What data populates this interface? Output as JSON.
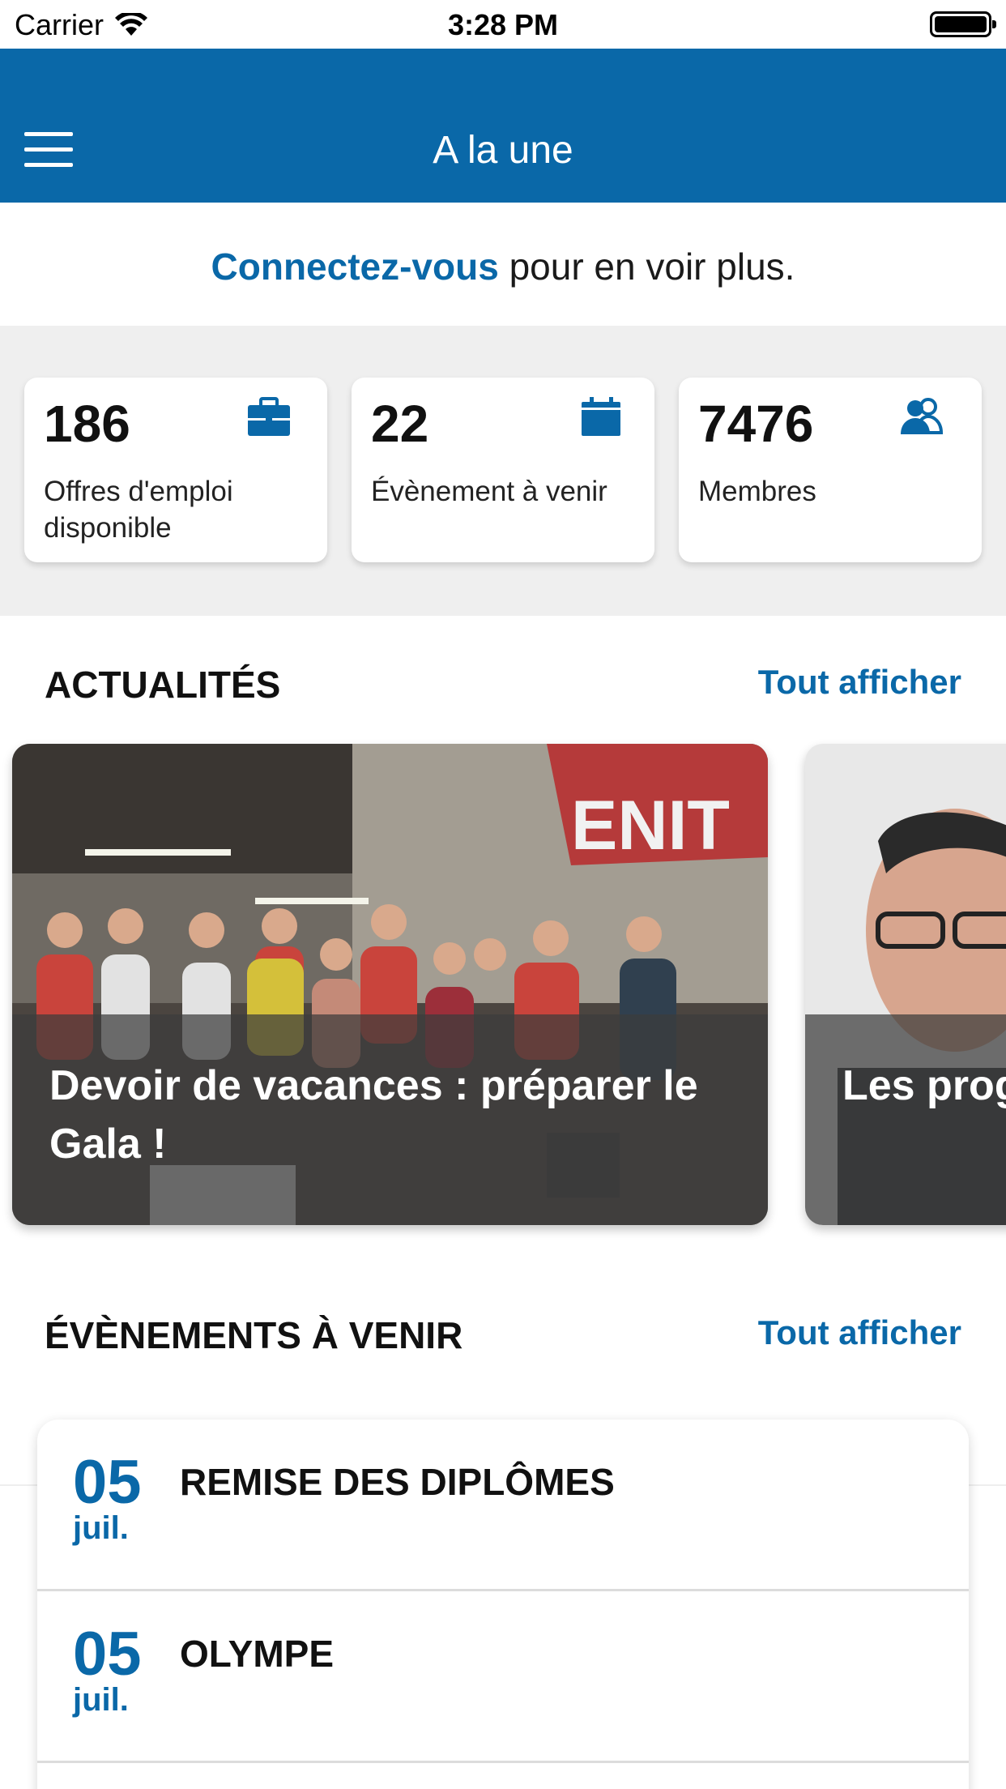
{
  "status_bar": {
    "carrier": "Carrier",
    "time": "3:28 PM"
  },
  "navbar": {
    "title": "A la une"
  },
  "connect_banner": {
    "link": "Connectez-vous",
    "text": " pour en voir plus."
  },
  "stats": [
    {
      "value": "186",
      "label": "Offres d'emploi disponible",
      "icon": "briefcase-icon"
    },
    {
      "value": "22",
      "label": "Évènement à venir",
      "icon": "calendar-icon"
    },
    {
      "value": "7476",
      "label": "Membres",
      "icon": "users-icon"
    }
  ],
  "news": {
    "title": "ACTUALITÉS",
    "view_all": "Tout afficher",
    "items": [
      {
        "title": "Devoir de vacances : préparer le Gala !",
        "sign_text": "ENIT"
      },
      {
        "title": "Les prog au poste"
      }
    ]
  },
  "events": {
    "title": "ÉVÈNEMENTS À VENIR",
    "view_all": "Tout afficher",
    "items": [
      {
        "day": "05",
        "month": "juil.",
        "title": "REMISE DES DIPLÔMES"
      },
      {
        "day": "05",
        "month": "juil.",
        "title": "OLYMPE"
      }
    ]
  },
  "colors": {
    "primary": "#0a68a8",
    "background_gray": "#efefef"
  }
}
